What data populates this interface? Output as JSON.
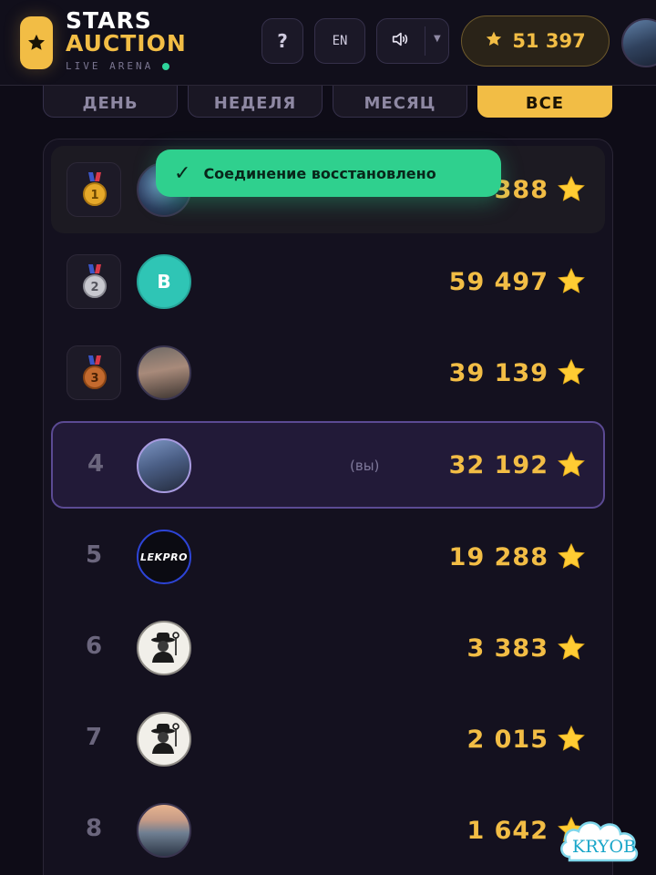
{
  "header": {
    "logo_line1": "STARS",
    "logo_line2": "AUCTION",
    "logo_sub": "LIVE ARENA",
    "help_label": "?",
    "lang_label": "EN",
    "balance": "51 397"
  },
  "tabs": [
    {
      "label": "ДЕНЬ",
      "active": false
    },
    {
      "label": "НЕДЕЛЯ",
      "active": false
    },
    {
      "label": "МЕСЯЦ",
      "active": false
    },
    {
      "label": "ВСЕ",
      "active": true
    }
  ],
  "toast": {
    "icon": "check-icon",
    "text": "Соединение восстановлено"
  },
  "leaderboard": [
    {
      "rank": "1",
      "medal": "gold",
      "avatar": "globe",
      "score": "388",
      "you": ""
    },
    {
      "rank": "2",
      "medal": "silver",
      "avatar_letter": "B",
      "score": "59 497",
      "you": ""
    },
    {
      "rank": "3",
      "medal": "bronze",
      "avatar": "photo",
      "score": "39 139",
      "you": ""
    },
    {
      "rank": "4",
      "medal": "",
      "avatar": "me",
      "score": "32 192",
      "you": "(вы)"
    },
    {
      "rank": "5",
      "medal": "",
      "avatar": "lekpro",
      "avatar_text": "LEKPRO",
      "score": "19 288",
      "you": ""
    },
    {
      "rank": "6",
      "medal": "",
      "avatar": "spy",
      "score": "3 383",
      "you": ""
    },
    {
      "rank": "7",
      "medal": "",
      "avatar": "spy",
      "score": "2 015",
      "you": ""
    },
    {
      "rank": "8",
      "medal": "",
      "avatar": "car",
      "score": "1 642",
      "you": ""
    }
  ],
  "watermark": "KRYOB",
  "colors": {
    "accent": "#f2bd45",
    "background": "#0e0c17",
    "toast": "#2fd08e",
    "me_highlight": "#5b4a93",
    "live_dot": "#2ed49b"
  }
}
